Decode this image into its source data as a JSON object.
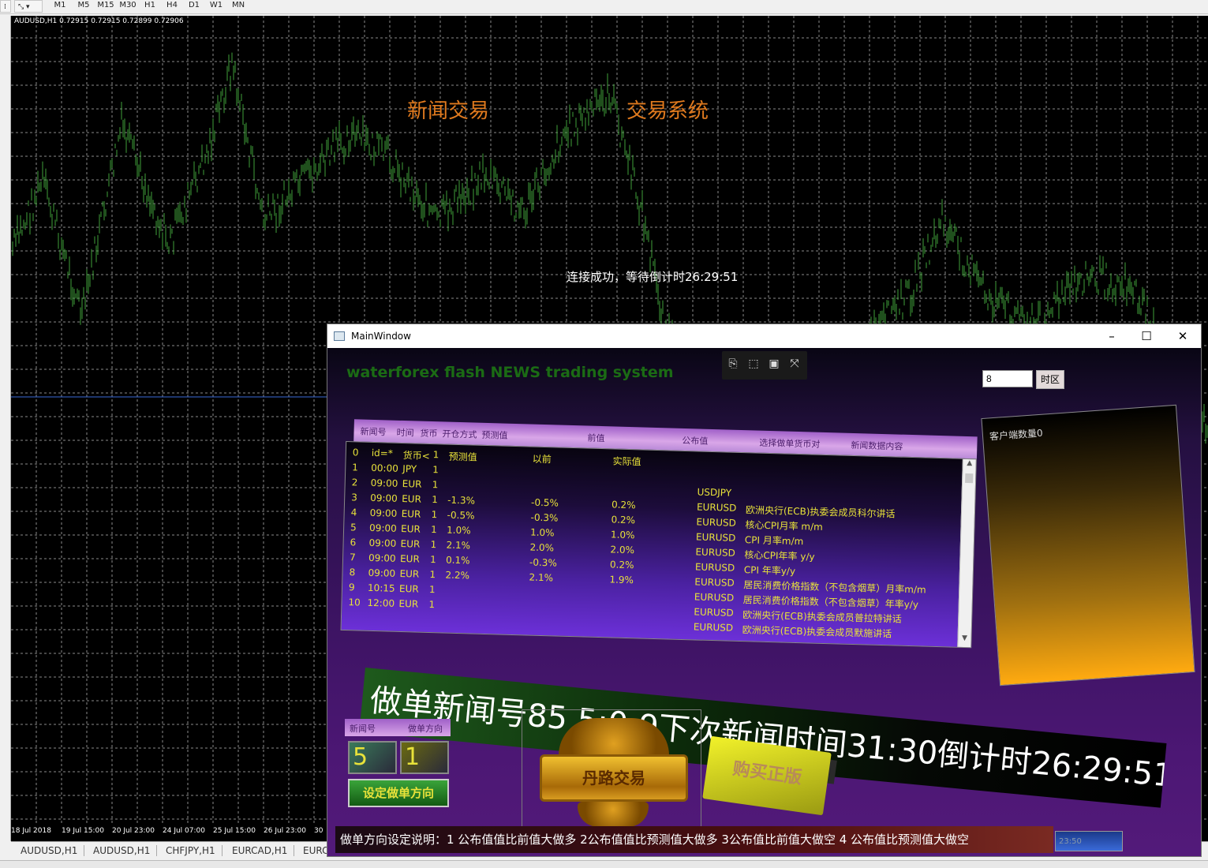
{
  "toolbar": {
    "timeframes": [
      "M1",
      "M5",
      "M15",
      "M30",
      "H1",
      "H4",
      "D1",
      "W1",
      "MN"
    ]
  },
  "chart": {
    "info": "AUDUSD,H1  0.72915 0.72915 0.72899 0.72906",
    "overlay_left": "新闻交易",
    "overlay_right": "交易系统",
    "status": "连接成功，等待倒计时26:29:51",
    "time_labels": [
      "18 Jul 2018",
      "19 Jul 15:00",
      "20 Jul 23:00",
      "24 Jul 07:00",
      "25 Jul 15:00",
      "26 Jul 23:00",
      "30"
    ]
  },
  "symbol_tabs": [
    "AUDUSD,H1",
    "AUDUSD,H1",
    "CHFJPY,H1",
    "EURCAD,H1",
    "EURC"
  ],
  "window": {
    "title": "MainWindow",
    "minimize": "–",
    "maximize": "☐",
    "close": "✕"
  },
  "app": {
    "brand": "waterforex flash NEWS trading system",
    "timezone_value": "8",
    "timezone_button": "时区",
    "table_headers": {
      "news_no": "新闻号",
      "time": "时间",
      "currency": "货币",
      "open_mode": "开仓方式",
      "forecast": "预测值",
      "previous": "前值",
      "actual": "公布值",
      "select_pair": "选择做单货币对",
      "content": "新闻数据内容"
    },
    "rows": [
      {
        "n": "0",
        "time": "id=*",
        "cur": "货币<",
        "mode": "1",
        "fc": "预测值",
        "prev": "以前",
        "act": "实际值",
        "pair": "",
        "desc": ""
      },
      {
        "n": "1",
        "time": "00:00",
        "cur": "JPY",
        "mode": "1",
        "fc": "",
        "prev": "",
        "act": "",
        "pair": "",
        "desc": ""
      },
      {
        "n": "2",
        "time": "09:00",
        "cur": "EUR",
        "mode": "1",
        "fc": "",
        "prev": "",
        "act": "",
        "pair": "USDJPY",
        "desc": ""
      },
      {
        "n": "3",
        "time": "09:00",
        "cur": "EUR",
        "mode": "1",
        "fc": "-1.3%",
        "prev": "-0.5%",
        "act": "0.2%",
        "pair": "EURUSD",
        "desc": "欧洲央行(ECB)执委会成员科尔讲话"
      },
      {
        "n": "4",
        "time": "09:00",
        "cur": "EUR",
        "mode": "1",
        "fc": "-0.5%",
        "prev": "-0.3%",
        "act": "0.2%",
        "pair": "EURUSD",
        "desc": "核心CPI月率 m/m"
      },
      {
        "n": "5",
        "time": "09:00",
        "cur": "EUR",
        "mode": "1",
        "fc": "1.0%",
        "prev": "1.0%",
        "act": "1.0%",
        "pair": "EURUSD",
        "desc": "CPI 月率m/m"
      },
      {
        "n": "6",
        "time": "09:00",
        "cur": "EUR",
        "mode": "1",
        "fc": "2.1%",
        "prev": "2.0%",
        "act": "2.0%",
        "pair": "EURUSD",
        "desc": "核心CPI年率 y/y"
      },
      {
        "n": "7",
        "time": "09:00",
        "cur": "EUR",
        "mode": "1",
        "fc": "0.1%",
        "prev": "-0.3%",
        "act": "0.2%",
        "pair": "EURUSD",
        "desc": "CPI 年率y/y"
      },
      {
        "n": "8",
        "time": "09:00",
        "cur": "EUR",
        "mode": "1",
        "fc": "2.2%",
        "prev": "2.1%",
        "act": "1.9%",
        "pair": "EURUSD",
        "desc": "居民消费价格指数（不包含烟草）月率m/m"
      },
      {
        "n": "9",
        "time": "10:15",
        "cur": "EUR",
        "mode": "1",
        "fc": "",
        "prev": "",
        "act": "",
        "pair": "EURUSD",
        "desc": "居民消费价格指数（不包含烟草）年率y/y"
      },
      {
        "n": "10",
        "time": "12:00",
        "cur": "EUR",
        "mode": "1",
        "fc": "",
        "prev": "",
        "act": "",
        "pair": "EURUSD",
        "desc": "欧洲央行(ECB)执委会成员普拉特讲话"
      },
      {
        "n": "",
        "time": "",
        "cur": "",
        "mode": "",
        "fc": "",
        "prev": "",
        "act": "",
        "pair": "EURUSD",
        "desc": "欧洲央行(ECB)执委会成员默施讲话"
      }
    ],
    "client_count": "客户端数量0",
    "banner": "做单新闻号85  5:0:9下次新闻时间31:30倒计时26:29:51",
    "side_header": {
      "news_no": "新闻号",
      "direction": "做单方向"
    },
    "news_no_value": "5",
    "direction_value": "1",
    "set_button": "设定做单方向",
    "logo_text": "丹路交易",
    "buy_button": "购买正版",
    "instructions": "做单方向设定说明：1 公布值值比前值大做多  2公布值值比预测值大做多  3公布值比前值大做空 4 公布值比预测值大做空",
    "clock": "23:50"
  },
  "colors": {
    "chart_bg": "#000000",
    "candle": "#3fa03a",
    "grid": "#8a8a8a",
    "accent_yellow": "#e8e23a",
    "accent_orange": "#e07a1e"
  }
}
